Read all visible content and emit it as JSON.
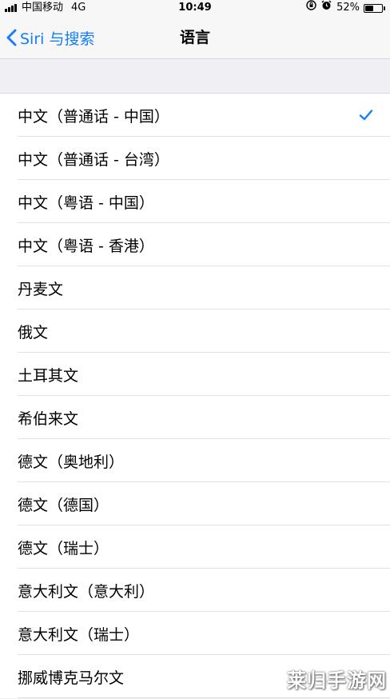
{
  "status_bar": {
    "carrier": "中国移动",
    "network": "4G",
    "time": "10:49",
    "battery_percent": "52%",
    "battery_level": 0.52,
    "icons": [
      "rotation-lock-icon",
      "alarm-icon"
    ]
  },
  "nav": {
    "back_label": "Siri 与搜索",
    "title": "语言"
  },
  "languages": [
    {
      "label": "中文（普通话 - 中国）",
      "selected": true
    },
    {
      "label": "中文（普通话 - 台湾）",
      "selected": false
    },
    {
      "label": "中文（粤语 - 中国）",
      "selected": false
    },
    {
      "label": "中文（粤语 - 香港）",
      "selected": false
    },
    {
      "label": "丹麦文",
      "selected": false
    },
    {
      "label": "俄文",
      "selected": false
    },
    {
      "label": "土耳其文",
      "selected": false
    },
    {
      "label": "希伯来文",
      "selected": false
    },
    {
      "label": "德文（奥地利）",
      "selected": false
    },
    {
      "label": "德文（德国）",
      "selected": false
    },
    {
      "label": "德文（瑞士）",
      "selected": false
    },
    {
      "label": "意大利文（意大利）",
      "selected": false
    },
    {
      "label": "意大利文（瑞士）",
      "selected": false
    },
    {
      "label": "挪威博克马尔文",
      "selected": false
    }
  ],
  "watermark": "莱归手游网",
  "colors": {
    "accent": "#147efb",
    "background": "#efeff4",
    "separator": "#e1e1e4"
  }
}
